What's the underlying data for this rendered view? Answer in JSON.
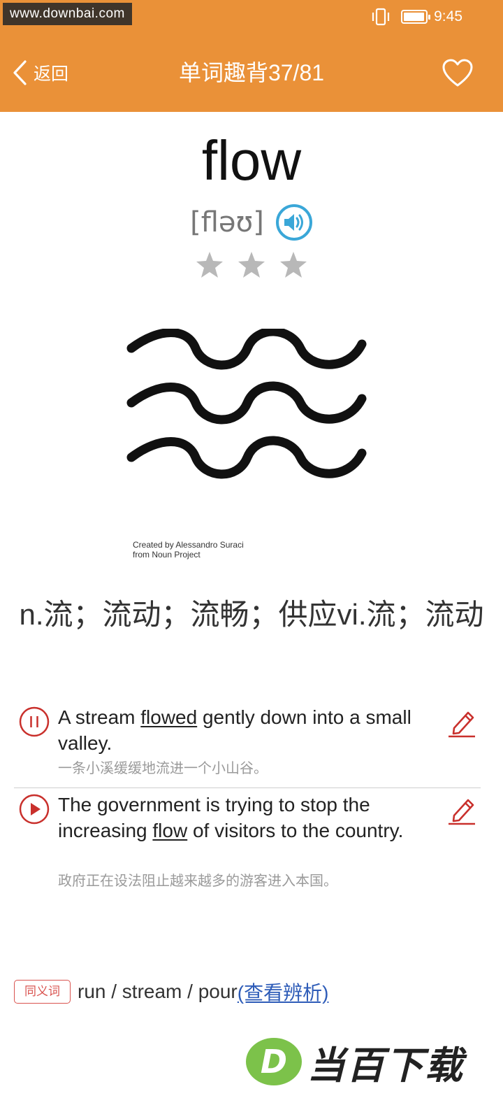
{
  "status_bar": {
    "watermark": "www.downbai.com",
    "time": "9:45"
  },
  "header": {
    "back_label": "返回",
    "title": "单词趣背37/81"
  },
  "word": {
    "text": "flow",
    "phonetic": "[fləʊ]",
    "stars_count": 3
  },
  "illustration": {
    "credit_line1": "Created by Alessandro Suraci",
    "credit_line2": "from Noun Project"
  },
  "definition": "n.流；流动；流畅；供应vi.流；流动",
  "examples": [
    {
      "en_before": "A stream ",
      "en_highlight": "flowed",
      "en_after": " gently down into a small valley.",
      "cn": "一条小溪缓缓地流进一个小山谷。",
      "state": "playing"
    },
    {
      "en_before": "The government is trying to stop the increasing ",
      "en_highlight": "flow",
      "en_after": " of visitors to the country.",
      "cn": "政府正在设法阻止越来越多的游客进入本国。",
      "state": "paused"
    }
  ],
  "synonyms": {
    "tag": "同义词",
    "words": "run / stream / pour",
    "link": "(查看辨析)"
  },
  "logo": {
    "letter": "D",
    "text": "当百下载"
  },
  "colors": {
    "header": "#ea9138",
    "accent_red": "#d9534f",
    "link_blue": "#2e5cb8",
    "speaker_blue": "#3aa7d8"
  }
}
